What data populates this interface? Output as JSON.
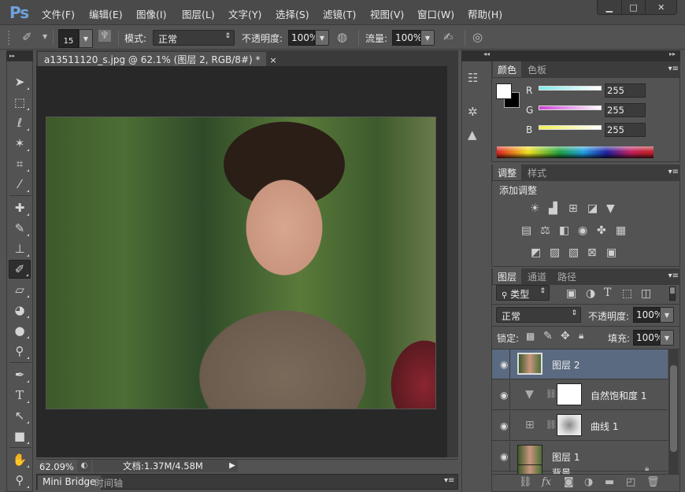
{
  "app": {
    "logo": "Ps"
  },
  "menu": [
    {
      "label": "文件(F)"
    },
    {
      "label": "编辑(E)"
    },
    {
      "label": "图像(I)"
    },
    {
      "label": "图层(L)"
    },
    {
      "label": "文字(Y)"
    },
    {
      "label": "选择(S)"
    },
    {
      "label": "滤镜(T)"
    },
    {
      "label": "视图(V)"
    },
    {
      "label": "窗口(W)"
    },
    {
      "label": "帮助(H)"
    }
  ],
  "window_controls": {
    "minimize": "▁",
    "maximize": "□",
    "close": "✕"
  },
  "options": {
    "brush_size": "15",
    "mode_label": "模式:",
    "mode_value": "正常",
    "opacity_label": "不透明度:",
    "opacity_value": "100%",
    "flow_label": "流量:",
    "flow_value": "100%"
  },
  "document": {
    "tab_title": "a13511120_s.jpg @ 62.1% (图层 2, RGB/8#) *",
    "close": "×"
  },
  "status": {
    "zoom": "62.09%",
    "doc_info": "文档:1.37M/4.58M"
  },
  "bottom_tabs": [
    {
      "label": "Mini Bridge"
    },
    {
      "label": "时间轴"
    }
  ],
  "color_panel": {
    "tabs": [
      "颜色",
      "色板"
    ],
    "channels": [
      {
        "name": "R",
        "value": "255",
        "color": "#7fe8ec"
      },
      {
        "name": "G",
        "value": "255",
        "color": "#d040d8"
      },
      {
        "name": "B",
        "value": "255",
        "color": "#f0f050"
      }
    ],
    "foreground": "#ffffff",
    "background": "#000000"
  },
  "adjust_panel": {
    "tabs": [
      "调整",
      "样式"
    ],
    "heading": "添加调整"
  },
  "layers_panel": {
    "tabs": [
      "图层",
      "通道",
      "路径"
    ],
    "filter": "类型",
    "blend_mode": "正常",
    "opacity_label": "不透明度:",
    "opacity_value": "100%",
    "lock_label": "锁定:",
    "fill_label": "填充:",
    "fill_value": "100%",
    "layers": [
      {
        "name": "图层 2",
        "selected": true
      },
      {
        "name": "自然饱和度 1"
      },
      {
        "name": "曲线 1"
      },
      {
        "name": "图层 1"
      },
      {
        "name": "背景"
      }
    ]
  }
}
